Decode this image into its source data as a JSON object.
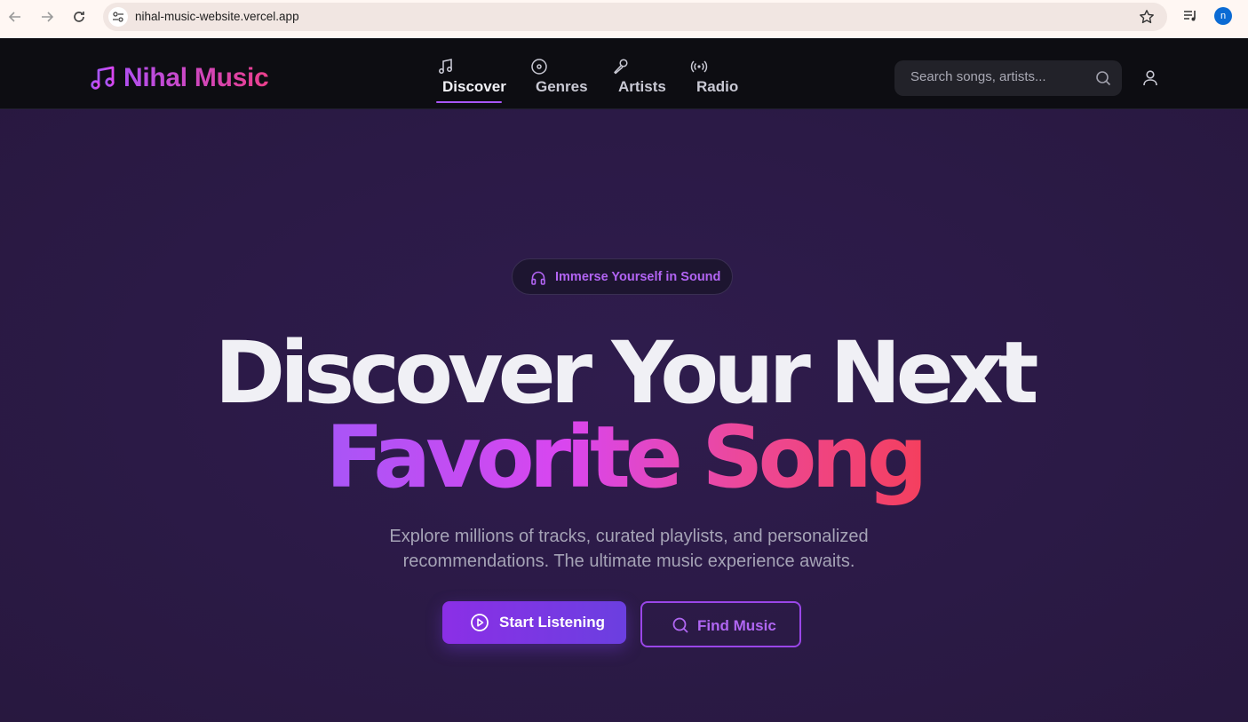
{
  "browser": {
    "url": "nihal-music-website.vercel.app",
    "profile_initial": "n"
  },
  "header": {
    "brand": "Nihal Music",
    "nav": [
      {
        "label": "Discover",
        "icon": "music-note-icon",
        "active": true
      },
      {
        "label": "Genres",
        "icon": "disc-icon",
        "active": false
      },
      {
        "label": "Artists",
        "icon": "microphone-icon",
        "active": false
      },
      {
        "label": "Radio",
        "icon": "radio-icon",
        "active": false
      }
    ],
    "search_placeholder": "Search songs, artists..."
  },
  "hero": {
    "badge": "Immerse Yourself in Sound",
    "title_line1": "Discover Your Next",
    "title_line2": "Favorite Song",
    "subtitle_line1": "Explore millions of tracks, curated playlists, and personalized",
    "subtitle_line2": "recommendations. The ultimate music experience awaits.",
    "primary_button": "Start Listening",
    "secondary_button": "Find Music"
  },
  "colors": {
    "accent": "#a855f7",
    "pink": "#ec4899",
    "background": "#2b1a46",
    "header": "#0d0d12"
  }
}
